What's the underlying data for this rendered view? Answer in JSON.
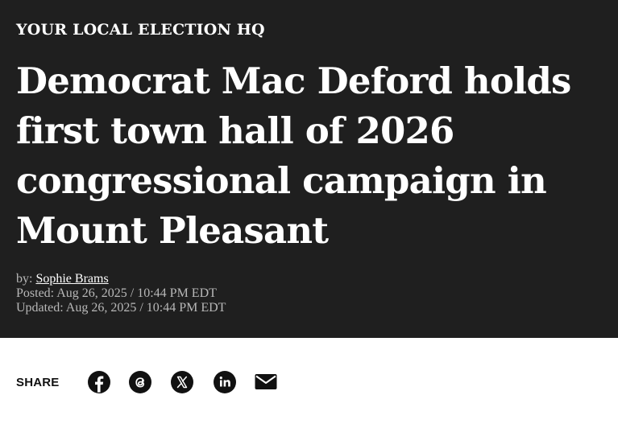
{
  "section": {
    "kicker": "YOUR LOCAL ELECTION HQ"
  },
  "article": {
    "headline": "Democrat Mac Deford holds first town hall of 2026 congressional campaign in Mount Pleasant",
    "byline_prefix": "by: ",
    "author": "Sophie Brams",
    "posted": "Posted: Aug 26, 2025 / 10:44 PM EDT",
    "updated": "Updated: Aug 26, 2025 / 10:44 PM EDT"
  },
  "share": {
    "label": "SHARE",
    "icons": [
      "facebook-icon",
      "threads-icon",
      "x-icon",
      "linkedin-icon",
      "email-icon"
    ]
  },
  "colors": {
    "hero_background": "#1f1f1f",
    "text_primary": "#ffffff",
    "meta_text": "#b8b8b8",
    "icon_dark": "#111111"
  }
}
